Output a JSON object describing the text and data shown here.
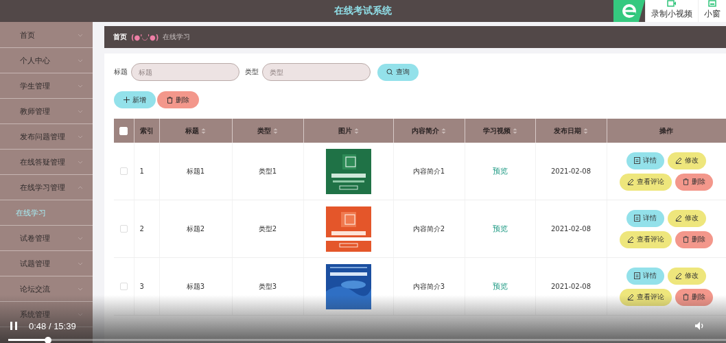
{
  "header": {
    "title": "在线考试系统",
    "toolbar": [
      {
        "label": "录制小视频",
        "kind": "record"
      },
      {
        "label": "小窗",
        "kind": "window"
      }
    ]
  },
  "sidebar": {
    "items": [
      {
        "label": "首页",
        "expanded": false
      },
      {
        "label": "个人中心",
        "expanded": false
      },
      {
        "label": "学生管理",
        "expanded": false
      },
      {
        "label": "教师管理",
        "expanded": false
      },
      {
        "label": "发布问题管理",
        "expanded": false
      },
      {
        "label": "在线答疑管理",
        "expanded": false
      },
      {
        "label": "在线学习管理",
        "expanded": true,
        "children": [
          {
            "label": "在线学习",
            "selected": true
          }
        ]
      },
      {
        "label": "试卷管理",
        "expanded": false
      },
      {
        "label": "试题管理",
        "expanded": false
      },
      {
        "label": "论坛交流",
        "expanded": false
      },
      {
        "label": "系统管理",
        "expanded": false
      }
    ]
  },
  "breadcrumb": {
    "home": "首页",
    "emoticon": "(●'◡'●)",
    "current": "在线学习"
  },
  "search": {
    "fields": [
      {
        "label": "标题",
        "placeholder": "标题"
      },
      {
        "label": "类型",
        "placeholder": "类型"
      }
    ],
    "button": "查询"
  },
  "actions": [
    {
      "label": "新增",
      "kind": "add"
    },
    {
      "label": "删除",
      "kind": "delete"
    }
  ],
  "table": {
    "all_checked": false,
    "columns": [
      {
        "label": "索引",
        "sortable": false
      },
      {
        "label": "标题",
        "sortable": true
      },
      {
        "label": "类型",
        "sortable": true
      },
      {
        "label": "图片",
        "sortable": true
      },
      {
        "label": "内容简介",
        "sortable": true
      },
      {
        "label": "学习视频",
        "sortable": true
      },
      {
        "label": "发布日期",
        "sortable": true
      },
      {
        "label": "操作",
        "sortable": false
      }
    ],
    "rows": [
      {
        "checked": false,
        "index": "1",
        "title": "标题1",
        "type": "类型1",
        "intro": "内容简介1",
        "video": "预览",
        "date": "2021-02-08",
        "actions": [
          {
            "label": "详情",
            "kind": "detail"
          },
          {
            "label": "修改",
            "kind": "edit"
          },
          {
            "label": "查看评论",
            "kind": "comments"
          },
          {
            "label": "删除",
            "kind": "delete"
          }
        ]
      },
      {
        "checked": false,
        "index": "2",
        "title": "标题2",
        "type": "类型2",
        "intro": "内容简介2",
        "video": "预览",
        "date": "2021-02-08",
        "actions": [
          {
            "label": "详情",
            "kind": "detail"
          },
          {
            "label": "修改",
            "kind": "edit"
          },
          {
            "label": "查看评论",
            "kind": "comments"
          },
          {
            "label": "删除",
            "kind": "delete"
          }
        ]
      },
      {
        "checked": false,
        "index": "3",
        "title": "标题3",
        "type": "类型3",
        "intro": "内容简介3",
        "video": "预览",
        "date": "2021-02-08",
        "actions": [
          {
            "label": "详情",
            "kind": "detail"
          },
          {
            "label": "修改",
            "kind": "edit"
          },
          {
            "label": "查看评论",
            "kind": "comments"
          },
          {
            "label": "删除",
            "kind": "delete"
          }
        ]
      }
    ]
  },
  "player": {
    "playing": true,
    "time": "0:48 / 15:39",
    "level": 0.055
  }
}
